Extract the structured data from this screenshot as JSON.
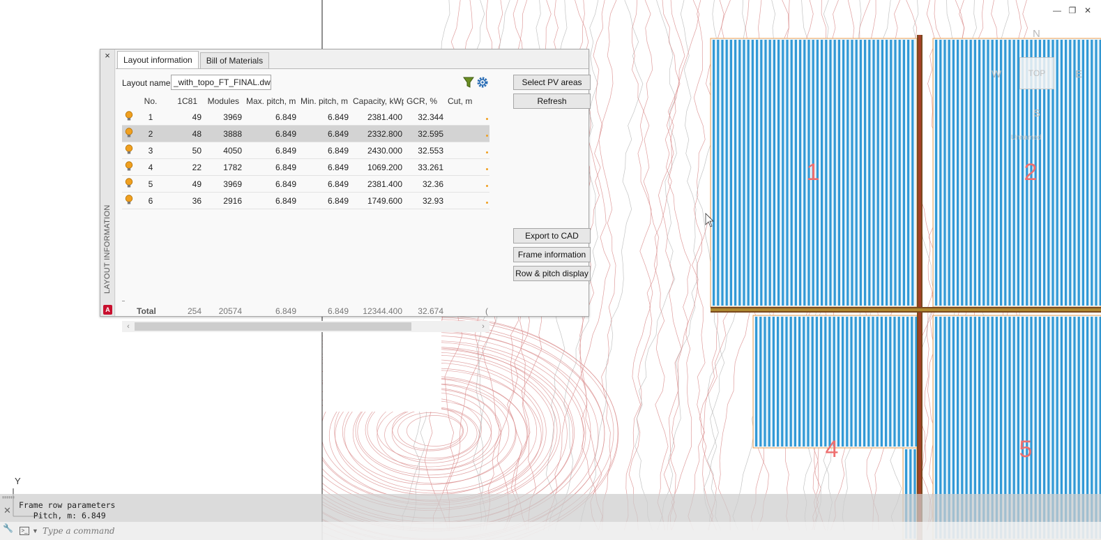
{
  "window_controls": {
    "minimize": "—",
    "restore": "❐",
    "close": "✕"
  },
  "viewcube": {
    "north": "N",
    "west": "W",
    "east": "E",
    "south": "S",
    "top_face": "TOP",
    "ucs_label": "Unnamed"
  },
  "ucs": {
    "y_label": "Y"
  },
  "drawing": {
    "area_labels": [
      "1",
      "2",
      "4",
      "5"
    ],
    "colors": {
      "contour": "#d98c8c",
      "contour_light": "#b9b9b9",
      "pv_row": "#1d8fd1",
      "pv_outline": "#f0a050",
      "road": "#7a4a1f",
      "label": "#ee6f6f"
    }
  },
  "palette": {
    "vertical_title": "LAYOUT INFORMATION",
    "close": "×",
    "logo": "A",
    "tabs": [
      {
        "label": "Layout information",
        "active": true
      },
      {
        "label": "Bill of Materials",
        "active": false
      }
    ],
    "layout_name_label": "Layout name",
    "layout_name_value": "_with_topo_FT_FINAL.dwg",
    "table": {
      "columns": [
        "No.",
        "1C81",
        "Modules",
        "Max. pitch, m",
        "Min. pitch, m",
        "Capacity, kWp",
        "GCR, %",
        "Cut, m"
      ],
      "rows": [
        {
          "no": "1",
          "c1": "49",
          "modules": "3969",
          "max": "6.849",
          "min": "6.849",
          "cap": "2381.400",
          "gcr": "32.344",
          "selected": false
        },
        {
          "no": "2",
          "c1": "48",
          "modules": "3888",
          "max": "6.849",
          "min": "6.849",
          "cap": "2332.800",
          "gcr": "32.595",
          "selected": true
        },
        {
          "no": "3",
          "c1": "50",
          "modules": "4050",
          "max": "6.849",
          "min": "6.849",
          "cap": "2430.000",
          "gcr": "32.553",
          "selected": false
        },
        {
          "no": "4",
          "c1": "22",
          "modules": "1782",
          "max": "6.849",
          "min": "6.849",
          "cap": "1069.200",
          "gcr": "33.261",
          "selected": false
        },
        {
          "no": "5",
          "c1": "49",
          "modules": "3969",
          "max": "6.849",
          "min": "6.849",
          "cap": "2381.400",
          "gcr": "32.36",
          "selected": false
        },
        {
          "no": "6",
          "c1": "36",
          "modules": "2916",
          "max": "6.849",
          "min": "6.849",
          "cap": "1749.600",
          "gcr": "32.93",
          "selected": false
        }
      ],
      "total": {
        "label": "Total",
        "c1": "254",
        "modules": "20574",
        "max": "6.849",
        "min": "6.849",
        "cap": "12344.400",
        "gcr": "32.674",
        "cut": "("
      }
    },
    "buttons": {
      "select_pv": "Select PV areas",
      "refresh": "Refresh",
      "export_cad": "Export to CAD",
      "frame_info": "Frame information",
      "row_pitch": "Row & pitch display"
    }
  },
  "command_line": {
    "history": [
      "Frame row parameters",
      "   Pitch, m: 6.849"
    ],
    "placeholder": "Type a command"
  }
}
